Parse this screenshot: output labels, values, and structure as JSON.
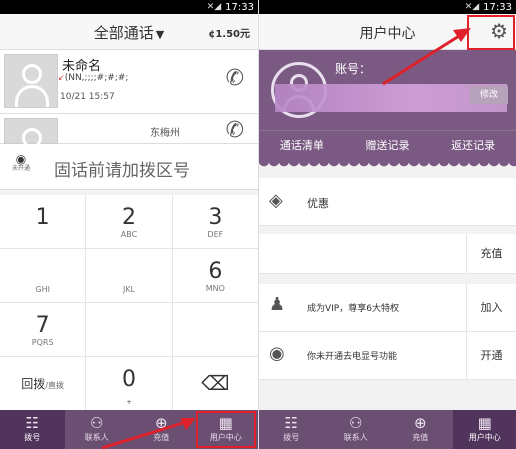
{
  "status": {
    "time": "17:33"
  },
  "left": {
    "header": {
      "title": "全部通话",
      "balance": "1.50元"
    },
    "call": {
      "name": "未命名",
      "number": "(NN,;;;;#;#;#;",
      "time": "10/21 15:57"
    },
    "call2": {
      "text": "东梅州"
    },
    "dial": {
      "logo_sub": "未开通",
      "hint": "固话前请加拨区号"
    },
    "keys": [
      [
        {
          "num": "1",
          "letters": ""
        },
        {
          "num": "2",
          "letters": "ABC"
        },
        {
          "num": "3",
          "letters": "DEF"
        }
      ],
      [
        {
          "num": "",
          "letters": "GHI"
        },
        {
          "num": "",
          "letters": "JKL"
        },
        {
          "num": "6",
          "letters": "MNO"
        }
      ],
      [
        {
          "num": "7",
          "letters": "PQRS"
        },
        {
          "num": "",
          "letters": ""
        },
        {
          "num": "",
          "letters": ""
        }
      ]
    ],
    "bottom_keys": {
      "redial": "回拨",
      "direct": "/直拨",
      "zero": "0",
      "zero_sub": "+"
    },
    "tabs": [
      "拨号",
      "联系人",
      "充值",
      "用户中心"
    ]
  },
  "right": {
    "header": {
      "title": "用户中心"
    },
    "profile": {
      "account": "账号：",
      "modify": "修改"
    },
    "tabs": [
      "通话清单",
      "赠送记录",
      "返还记录"
    ],
    "menu": [
      {
        "label": "优惠",
        "action": ""
      },
      {
        "label": "",
        "action": "充值"
      },
      {
        "label": "成为VIP，尊享6大特权",
        "action": "加入"
      },
      {
        "label": "你未开通去电显号功能",
        "action": "开通"
      }
    ],
    "tabbar": [
      "拨号",
      "联系人",
      "充值",
      "用户中心"
    ]
  },
  "colors": {
    "purple": "#7a5a82",
    "tabbar": "#6b4f73",
    "highlight": "#e0202a"
  }
}
